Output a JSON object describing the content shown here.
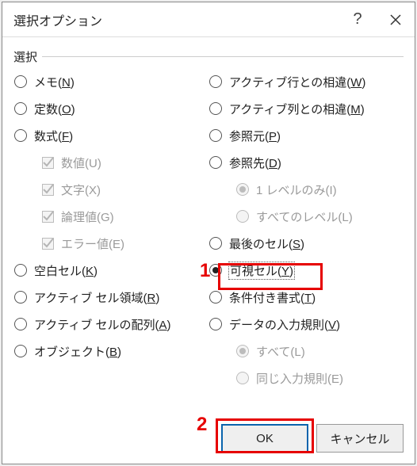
{
  "dialog": {
    "title": "選択オプション",
    "group_label": "選択"
  },
  "left": {
    "memo": {
      "text": "メモ(",
      "accel": "N",
      "after": ")"
    },
    "const": {
      "text": "定数(",
      "accel": "O",
      "after": ")"
    },
    "formula": {
      "text": "数式(",
      "accel": "F",
      "after": ")"
    },
    "num": {
      "text": "数値(U)"
    },
    "str": {
      "text": "文字(X)"
    },
    "logic": {
      "text": "論理値(G)"
    },
    "err": {
      "text": "エラー値(E)"
    },
    "blank": {
      "text": "空白セル(",
      "accel": "K",
      "after": ")"
    },
    "region": {
      "text": "アクティブ セル領域(",
      "accel": "R",
      "after": ")"
    },
    "array": {
      "text": "アクティブ セルの配列(",
      "accel": "A",
      "after": ")"
    },
    "object": {
      "text": "オブジェクト(",
      "accel": "B",
      "after": ")"
    }
  },
  "right": {
    "rowdiff": {
      "text": "アクティブ行との相違(",
      "accel": "W",
      "after": ")"
    },
    "coldiff": {
      "text": "アクティブ列との相違(",
      "accel": "M",
      "after": ")"
    },
    "prec": {
      "text": "参照元(",
      "accel": "P",
      "after": ")"
    },
    "dep": {
      "text": "参照先(",
      "accel": "D",
      "after": ")"
    },
    "one": {
      "text": "1 レベルのみ(I)"
    },
    "all": {
      "text": "すべてのレベル(L)"
    },
    "last": {
      "text": "最後のセル(",
      "accel": "S",
      "after": ")"
    },
    "visible": {
      "text": "可視セル(",
      "accel": "Y",
      "after": ")"
    },
    "cond": {
      "text": "条件付き書式(",
      "accel": "T",
      "after": ")"
    },
    "valid": {
      "text": "データの入力規則(",
      "accel": "V",
      "after": ")"
    },
    "v_all": {
      "text": "すべて(L)"
    },
    "v_same": {
      "text": "同じ入力規則(E)"
    }
  },
  "buttons": {
    "ok": "OK",
    "cancel": "キャンセル"
  },
  "annotations": {
    "num1": "1",
    "num2": "2"
  }
}
